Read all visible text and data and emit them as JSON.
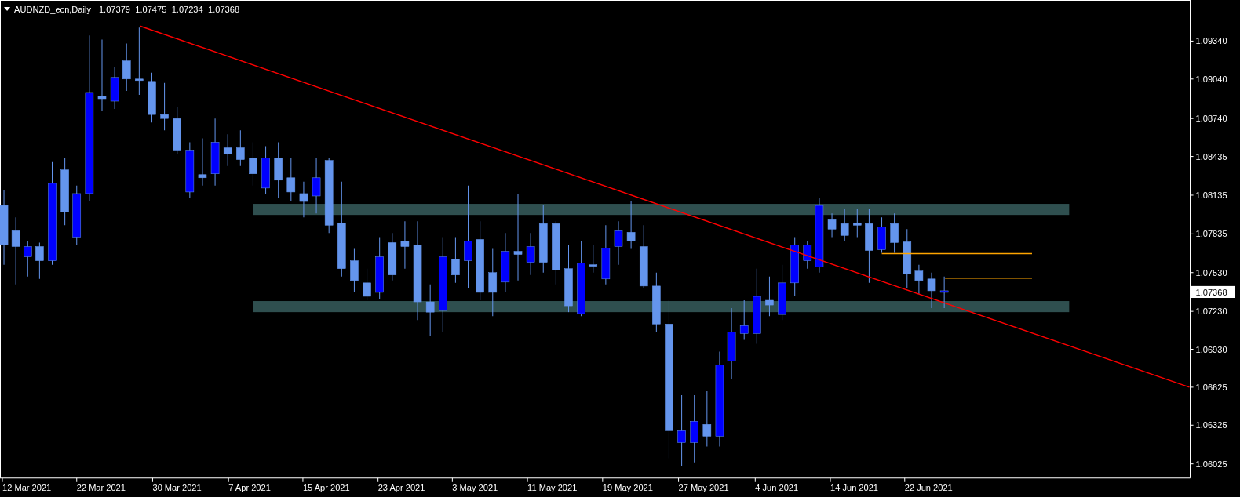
{
  "header": {
    "symbol": "AUDNZD_ecn,Daily",
    "ohlc": [
      "1.07379",
      "1.07475",
      "1.07234",
      "1.07368"
    ]
  },
  "price_axis": [
    "1.09340",
    "1.09040",
    "1.08740",
    "1.08435",
    "1.08135",
    "1.07835",
    "1.07530",
    "1.07230",
    "1.06930",
    "1.06625",
    "1.06325",
    "1.06025"
  ],
  "current_price": "1.07368",
  "time_axis": [
    "12 Mar 2021",
    "22 Mar 2021",
    "30 Mar 2021",
    "7 Apr 2021",
    "15 Apr 2021",
    "23 Apr 2021",
    "3 May 2021",
    "11 May 2021",
    "19 May 2021",
    "27 May 2021",
    "4 Jun 2021",
    "14 Jun 2021",
    "22 Jun 2021"
  ]
}
